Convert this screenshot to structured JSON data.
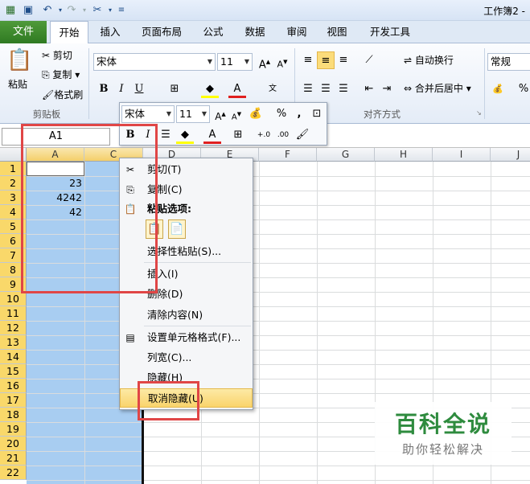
{
  "window": {
    "title": "工作簿2 -"
  },
  "qat": {
    "save_icon": "save-icon",
    "undo_icon": "undo-icon",
    "redo_icon": "redo-icon"
  },
  "tabs": [
    {
      "label": "文件"
    },
    {
      "label": "开始"
    },
    {
      "label": "插入"
    },
    {
      "label": "页面布局"
    },
    {
      "label": "公式"
    },
    {
      "label": "数据"
    },
    {
      "label": "审阅"
    },
    {
      "label": "视图"
    },
    {
      "label": "开发工具"
    }
  ],
  "ribbon": {
    "clipboard": {
      "paste": "粘贴",
      "cut": "剪切",
      "copy": "复制",
      "format_painter": "格式刷",
      "group_label": "剪贴板"
    },
    "font": {
      "name": "宋体",
      "size": "11",
      "bold": "B",
      "italic": "I",
      "underline": "U"
    },
    "alignment": {
      "wrap_text": "自动换行",
      "merge_center": "合并后居中",
      "group_label": "对齐方式"
    },
    "number": {
      "format": "常规",
      "percent": "%"
    }
  },
  "formula_bar": {
    "name_box": "A1"
  },
  "grid": {
    "columns": [
      "A",
      "C",
      "D",
      "E",
      "F",
      "G",
      "H",
      "I",
      "J"
    ],
    "rows": [
      "1",
      "2",
      "3",
      "4",
      "5",
      "6",
      "7",
      "8",
      "9",
      "10",
      "11",
      "12",
      "13",
      "14",
      "15",
      "16",
      "17",
      "18",
      "19",
      "20",
      "21",
      "22"
    ],
    "cells": [
      {
        "row": 2,
        "value": "23"
      },
      {
        "row": 3,
        "value": "4242"
      },
      {
        "row": 4,
        "value": "42"
      }
    ]
  },
  "mini_toolbar": {
    "font": "宋体",
    "size": "11",
    "bold": "B",
    "italic": "I",
    "percent": "%",
    "comma": ","
  },
  "context_menu": {
    "items": [
      {
        "label": "剪切(T)"
      },
      {
        "label": "复制(C)"
      },
      {
        "label": "粘贴选项:"
      },
      {
        "label": "选择性粘贴(S)..."
      },
      {
        "label": "插入(I)"
      },
      {
        "label": "删除(D)"
      },
      {
        "label": "清除内容(N)"
      },
      {
        "label": "设置单元格格式(F)..."
      },
      {
        "label": "列宽(C)..."
      },
      {
        "label": "隐藏(H)"
      },
      {
        "label": "取消隐藏(U)"
      }
    ]
  },
  "watermark": {
    "title": "百科全说",
    "subtitle": "助你轻松解决"
  },
  "colors": {
    "accent_green": "#3a8a2c",
    "selection": "#a8cdf1",
    "highlight": "#f9d46c",
    "annotation_red": "#e04646"
  }
}
